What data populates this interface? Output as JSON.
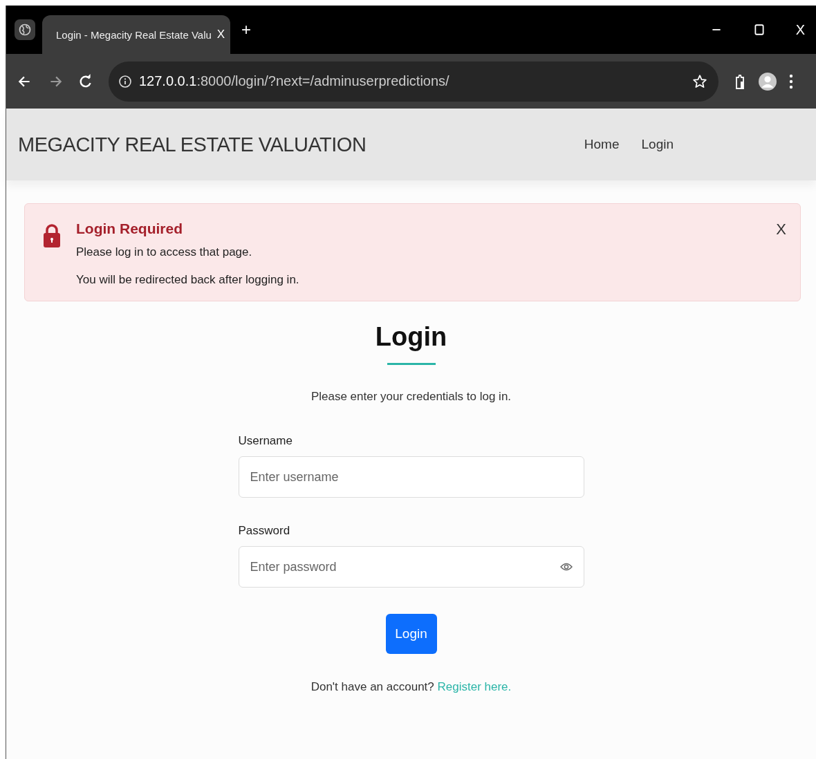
{
  "browser": {
    "tab_title": "Login - Megacity Real Estate Valu",
    "tab_close": "X",
    "new_tab": "+",
    "window_close": "X",
    "url_host": "127.0.0.1",
    "url_path": ":8000/login/?next=/adminuserpredictions/"
  },
  "navbar": {
    "brand": "MEGACITY REAL ESTATE VALUATION",
    "links": [
      {
        "label": "Home"
      },
      {
        "label": "Login"
      }
    ]
  },
  "alert": {
    "title": "Login Required",
    "lines": [
      "Please log in to access that page.",
      "You will be redirected back after logging in."
    ],
    "close": "X"
  },
  "form": {
    "heading": "Login",
    "subtitle": "Please enter your credentials to log in.",
    "fields": [
      {
        "label": "Username",
        "placeholder": "Enter username",
        "kind": "text"
      },
      {
        "label": "Password",
        "placeholder": "Enter password",
        "kind": "password"
      }
    ],
    "submit": "Login",
    "footer_text": "Don't have an account?",
    "footer_link": "Register here."
  }
}
